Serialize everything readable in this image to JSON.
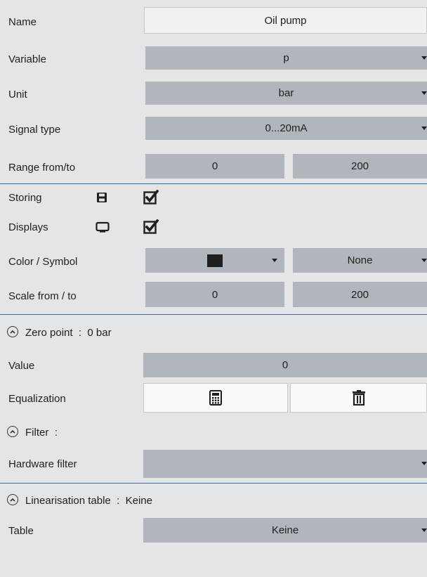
{
  "name": {
    "label": "Name",
    "value": "Oil pump"
  },
  "variable": {
    "label": "Variable",
    "value": "p"
  },
  "unit": {
    "label": "Unit",
    "value": "bar"
  },
  "signal_type": {
    "label": "Signal type",
    "value": "0...20mA"
  },
  "range": {
    "label": "Range from/to",
    "from": "0",
    "to": "200"
  },
  "storing": {
    "label": "Storing",
    "checked": true,
    "icon": "save-icon"
  },
  "displays": {
    "label": "Displays",
    "checked": true,
    "icon": "monitor-icon"
  },
  "color_symbol": {
    "label": "Color / Symbol",
    "color": "#1f1f1f",
    "symbol": "None"
  },
  "scale": {
    "label": "Scale from / to",
    "from": "0",
    "to": "200"
  },
  "zero_point": {
    "header": "Zero point",
    "sep": ":",
    "summary": "0 bar",
    "value_label": "Value",
    "value": "0",
    "equalization_label": "Equalization"
  },
  "filter": {
    "header": "Filter",
    "sep": ":",
    "hardware_label": "Hardware filter",
    "hardware_value": ""
  },
  "linearisation": {
    "header": "Linearisation table",
    "sep": ":",
    "summary": "Keine",
    "table_label": "Table",
    "table_value": "Keine"
  },
  "colors": {
    "control": "#b0b6bb",
    "separator": "#3a6aa6",
    "background": "#e3e5e7"
  }
}
